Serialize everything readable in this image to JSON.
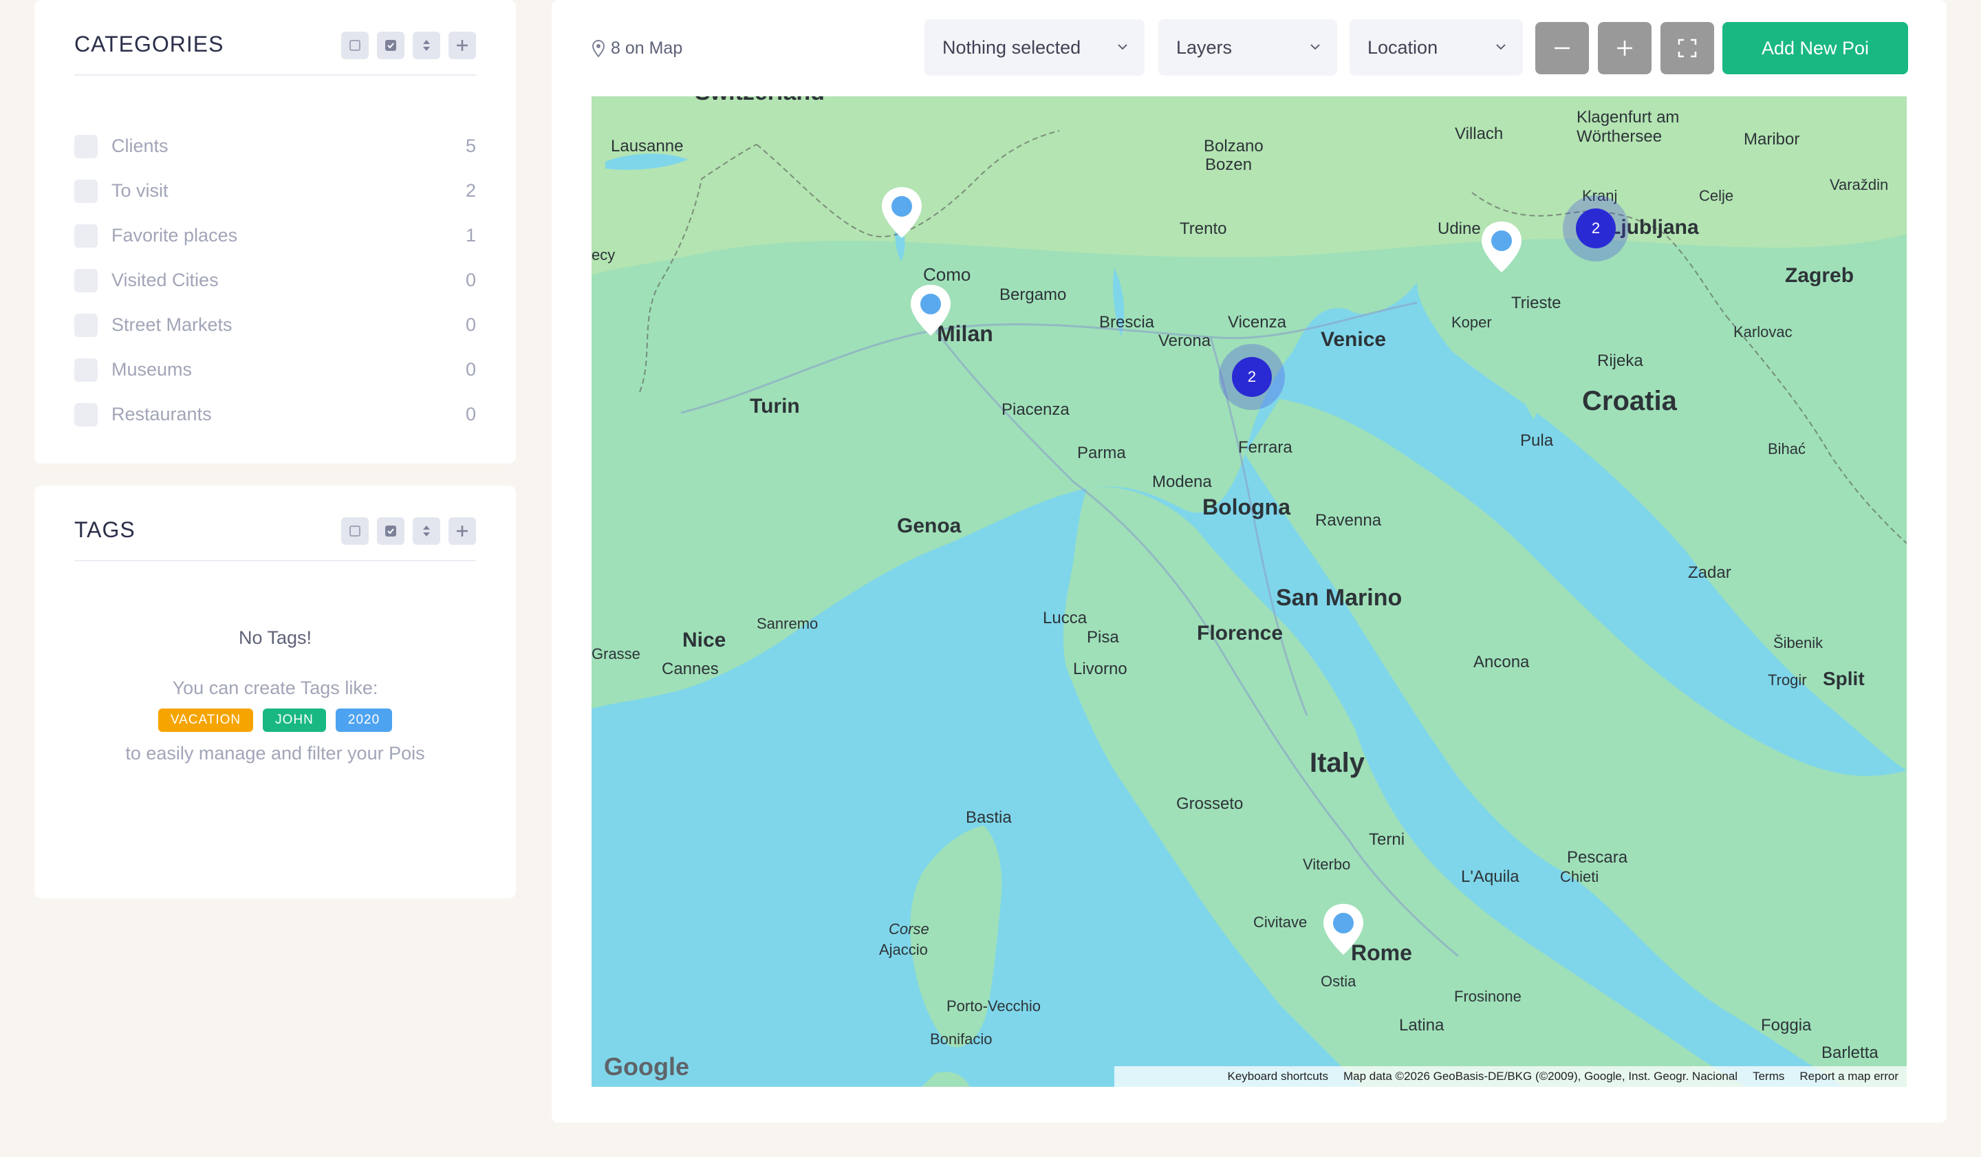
{
  "categories": {
    "title": "CATEGORIES",
    "items": [
      {
        "label": "Clients",
        "count": "5"
      },
      {
        "label": "To visit",
        "count": "2"
      },
      {
        "label": "Favorite places",
        "count": "1"
      },
      {
        "label": "Visited Cities",
        "count": "0"
      },
      {
        "label": "Street Markets",
        "count": "0"
      },
      {
        "label": "Museums",
        "count": "0"
      },
      {
        "label": "Restaurants",
        "count": "0"
      }
    ]
  },
  "tags": {
    "title": "TAGS",
    "empty_title": "No Tags!",
    "hint_before": "You can create Tags like:",
    "examples": [
      {
        "label": "VACATION",
        "color": "#f6a400"
      },
      {
        "label": "JOHN",
        "color": "#19b883"
      },
      {
        "label": "2020",
        "color": "#4da3f0"
      }
    ],
    "hint_after": "to easily manage and filter your Pois"
  },
  "toolbar": {
    "on_map": "8 on Map",
    "select_nothing": "Nothing selected",
    "select_layers": "Layers",
    "select_location": "Location",
    "add_poi": "Add New Poi"
  },
  "map": {
    "provider_logo": "Google",
    "footer": {
      "shortcuts": "Keyboard shortcuts",
      "data": "Map data ©2026 GeoBasis-DE/BKG (©2009), Google, Inst. Geogr. Nacional",
      "terms": "Terms",
      "report": "Report a map error"
    },
    "clusters": [
      {
        "count": "2"
      },
      {
        "count": "2"
      }
    ],
    "places": {
      "switzerland": "Switzerland",
      "lausanne": "Lausanne",
      "bolzano": "Bolzano",
      "bozen": "Bozen",
      "villach": "Villach",
      "klagenfurt": "Klagenfurt am",
      "worthersee": "Wörthersee",
      "maribor": "Maribor",
      "varazdin": "Varaždin",
      "celje": "Celje",
      "kranj": "Kranj",
      "ljubljana": "Ljubljana",
      "zagreb": "Zagreb",
      "trento": "Trento",
      "udine": "Udine",
      "como": "Como",
      "bergamo": "Bergamo",
      "milan": "Milan",
      "brescia": "Brescia",
      "vicenza": "Vicenza",
      "verona": "Verona",
      "venice": "Venice",
      "trieste": "Trieste",
      "koper": "Koper",
      "karlovac": "Karlovac",
      "rijeka": "Rijeka",
      "croatia": "Croatia",
      "turin": "Turin",
      "piacenza": "Piacenza",
      "parma": "Parma",
      "ferrara": "Ferrara",
      "pula": "Pula",
      "bihac": "Bihać",
      "modena": "Modena",
      "bologna": "Bologna",
      "genoa": "Genoa",
      "ravenna": "Ravenna",
      "zadar": "Zadar",
      "sanmarino": "San Marino",
      "sanremo": "Sanremo",
      "lucca": "Lucca",
      "pisa": "Pisa",
      "florence": "Florence",
      "nice": "Nice",
      "grasse": "Grasse",
      "cannes": "Cannes",
      "livorno": "Livorno",
      "ancona": "Ancona",
      "sibenik": "Šibenik",
      "trogir": "Trogir",
      "split": "Split",
      "italy": "Italy",
      "grosseto": "Grosseto",
      "bastia": "Bastia",
      "terni": "Terni",
      "pescara": "Pescara",
      "viterbo": "Viterbo",
      "laquila": "L'Aquila",
      "chieti": "Chieti",
      "corse": "Corse",
      "ajaccio": "Ajaccio",
      "civitavecchia": "Civitave",
      "rome": "Rome",
      "ostia": "Ostia",
      "frosinone": "Frosinone",
      "portovecchio": "Porto-Vecchio",
      "latina": "Latina",
      "foggia": "Foggia",
      "bonifacio": "Bonifacio",
      "barletta": "Barletta",
      "ecy": "ecy"
    }
  }
}
